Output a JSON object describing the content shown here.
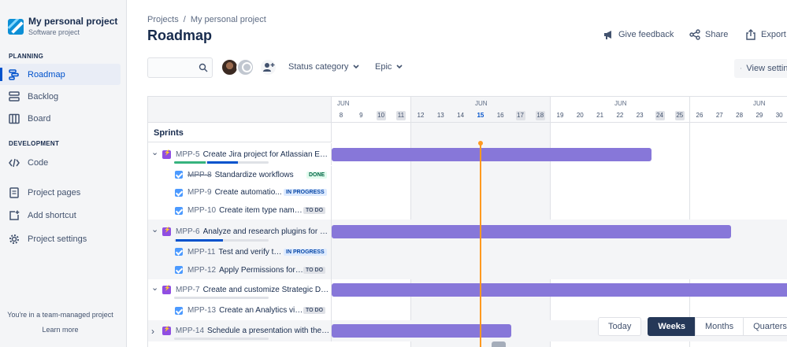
{
  "sidebar": {
    "project_name": "My personal project",
    "project_type": "Software project",
    "planning_label": "PLANNING",
    "development_label": "DEVELOPMENT",
    "items": [
      {
        "label": "Roadmap",
        "icon": "roadmap-icon",
        "active": true
      },
      {
        "label": "Backlog",
        "icon": "backlog-icon"
      },
      {
        "label": "Board",
        "icon": "board-icon"
      },
      {
        "label": "Code",
        "icon": "code-icon"
      },
      {
        "label": "Project pages",
        "icon": "pages-icon"
      },
      {
        "label": "Add shortcut",
        "icon": "add-shortcut-icon"
      },
      {
        "label": "Project settings",
        "icon": "gear-icon"
      }
    ],
    "team_note": "You're in a team-managed project",
    "learn_more": "Learn more"
  },
  "header": {
    "breadcrumb": [
      "Projects",
      "My personal project"
    ],
    "title": "Roadmap",
    "actions": [
      {
        "label": "Give feedback",
        "icon": "megaphone-icon"
      },
      {
        "label": "Share",
        "icon": "share-icon"
      },
      {
        "label": "Export",
        "icon": "export-icon"
      }
    ]
  },
  "filters": {
    "search_placeholder": "",
    "status_category": "Status category",
    "epic": "Epic",
    "view_settings": "View settings"
  },
  "timeline": {
    "weeks": [
      {
        "month": "JUN",
        "days": [
          "8",
          "9",
          "10",
          "11"
        ],
        "weekend": [
          false,
          false,
          true,
          true
        ],
        "shade": false
      },
      {
        "month": "JUN",
        "days": [
          "12",
          "13",
          "14",
          "15",
          "16",
          "17",
          "18"
        ],
        "weekend": [
          false,
          false,
          false,
          false,
          false,
          true,
          true
        ],
        "shade": true,
        "today_index": 3
      },
      {
        "month": "JUN",
        "days": [
          "19",
          "20",
          "21",
          "22",
          "23",
          "24",
          "25"
        ],
        "weekend": [
          false,
          false,
          false,
          false,
          false,
          true,
          true
        ],
        "shade": false
      },
      {
        "month": "JUN",
        "days": [
          "26",
          "27",
          "28",
          "29",
          "30"
        ],
        "weekend": [
          false,
          false,
          false,
          false,
          false
        ],
        "shade": false
      }
    ],
    "today": "15"
  },
  "sprints_label": "Sprints",
  "rows": [
    {
      "type": "epic",
      "key": "MPP-5",
      "summary": "Create Jira project for Atlassian Eng...",
      "expanded": true,
      "progress": {
        "done": 0.33,
        "in_progress": 0.33
      }
    },
    {
      "type": "story",
      "key": "MPP-8",
      "summary": "Standardize workflows",
      "status": "DONE",
      "done": true
    },
    {
      "type": "story",
      "key": "MPP-9",
      "summary": "Create automatio...",
      "status": "IN PROGRESS"
    },
    {
      "type": "story",
      "key": "MPP-10",
      "summary": "Create item type name...",
      "status": "TO DO"
    },
    {
      "type": "epic",
      "key": "MPP-6",
      "summary": "Analyze and research plugins for C-...",
      "expanded": true,
      "progress": {
        "done": 0,
        "in_progress": 0.5
      }
    },
    {
      "type": "story",
      "key": "MPP-11",
      "summary": "Test and verify th...",
      "status": "IN PROGRESS"
    },
    {
      "type": "story",
      "key": "MPP-12",
      "summary": "Apply Permissions for ...",
      "status": "TO DO"
    },
    {
      "type": "epic",
      "key": "MPP-7",
      "summary": "Create and customize Strategic Das...",
      "expanded": true,
      "progress": {
        "done": 0,
        "in_progress": 0
      }
    },
    {
      "type": "story",
      "key": "MPP-13",
      "summary": "Create an Analytics vie...",
      "status": "TO DO"
    },
    {
      "type": "epic",
      "key": "MPP-14",
      "summary": "Schedule a presentation with the t...",
      "expanded": false,
      "progress": {
        "done": 0,
        "in_progress": 0
      }
    }
  ],
  "zoom": {
    "today": "Today",
    "options": [
      "Weeks",
      "Months",
      "Quarters"
    ],
    "selected": "Weeks"
  },
  "colors": {
    "accent": "#0052cc",
    "epic_bar": "#8777d9",
    "today_line": "#ff991f"
  }
}
